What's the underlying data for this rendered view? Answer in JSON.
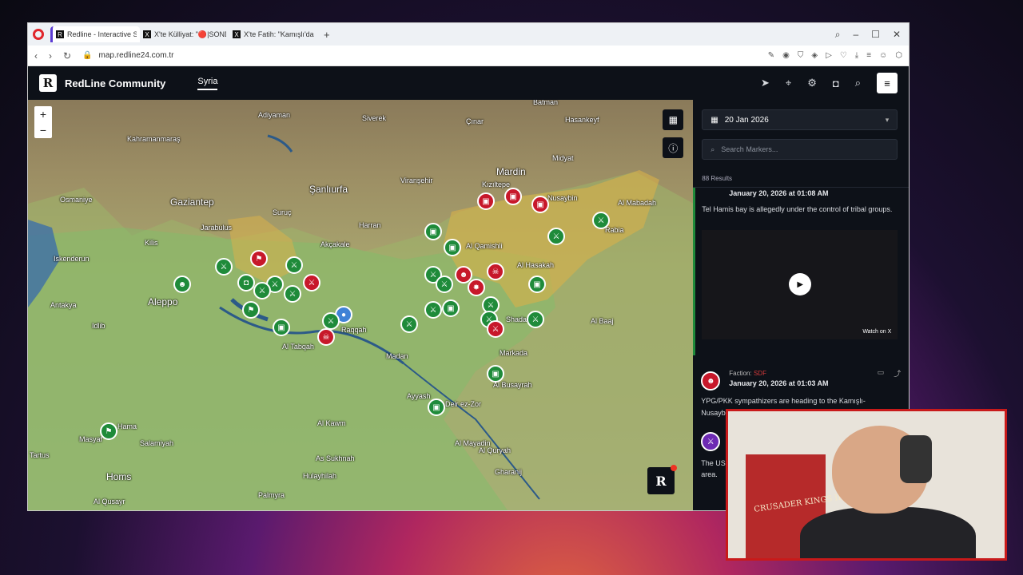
{
  "browser": {
    "tabs": [
      {
        "label": "Redline - Interactive Strat..."
      },
      {
        "label": "X'te Külliyat: \"🔴|SONDAKİ..."
      },
      {
        "label": "X'te Fatih: \"Kamışlı'da top..."
      }
    ],
    "new_tab": "+",
    "url": "map.redline24.com.tr"
  },
  "app": {
    "logo": "R",
    "brand": "RedLine Community",
    "region_tab": "Syria",
    "header_icons": [
      "route-icon",
      "pin-icon",
      "gear-icon",
      "camera-icon",
      "search-icon",
      "menu-icon"
    ]
  },
  "map": {
    "zoom_in": "+",
    "zoom_out": "−",
    "labels": [
      "Batman",
      "Adiyaman",
      "Siverek",
      "Çınar",
      "Kahramanmaraş",
      "Mardin",
      "Gaziantep",
      "Şanlıurfa",
      "Kızıltepe",
      "Nusaybin",
      "Osmaniye",
      "Kilis",
      "Jarabulus",
      "Akçakale",
      "Harran",
      "Al Qamishli",
      "Iskenderun",
      "Al Hasakah",
      "Antakya",
      "Aleppo",
      "Raqqah",
      "Al Tabqah",
      "Idlib",
      "Hama",
      "Homs",
      "Tartus",
      "Madan",
      "Ayyash",
      "Deir ez-Zor",
      "Al Kawm",
      "As Sukhnah",
      "Palmyra",
      "Al Mayadin",
      "Al Quryah",
      "Gharanij",
      "Hulayhilah",
      "Al Qusayr",
      "Rabia",
      "Al Mabadah",
      "Shadadi",
      "Markada",
      "Al Busayrah",
      "Al Baaj",
      "Salamiyah",
      "Masyaf",
      "Midyat",
      "Hasankeyf",
      "Viranşehir",
      "Suruç"
    ],
    "brand_badge": "R"
  },
  "sidebar": {
    "date": "20 Jan 2026",
    "search_placeholder": "Search Markers...",
    "results": "88 Results",
    "posts": [
      {
        "timestamp": "January 20, 2026 at 01:08 AM",
        "text": "Tel Hamis bay is allegedly under the control of tribal groups.",
        "video_label": "Watch on X"
      },
      {
        "faction_label": "Faction:",
        "faction_name": "SDF",
        "timestamp": "January 20, 2026 at 01:03 AM",
        "text": "YPG/PKK sympathizers are heading to the Kamışlı-Nusaybin",
        "text2": "The US",
        "text3": "area."
      }
    ]
  },
  "webcam": {
    "shirt_text": "CRUSADER KINGS III"
  },
  "colors": {
    "app_bg": "#0d1118",
    "friendly_marker": "#1f8b3a",
    "hostile_marker": "#c7182a",
    "neutral_marker": "#3f82d6",
    "sdf_area": "#d8b04a",
    "gov_area": "#7fbf6a"
  }
}
